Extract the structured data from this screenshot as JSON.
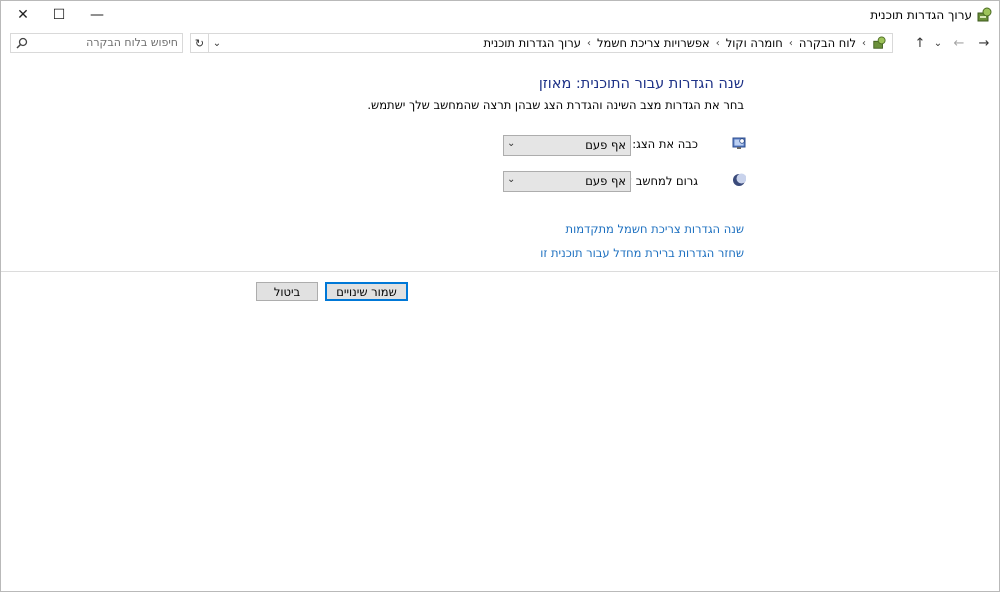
{
  "window": {
    "title": "ערוך הגדרות תוכנית",
    "close_glyph": "✕",
    "maximize_glyph": "☐",
    "minimize_glyph": "—"
  },
  "nav": {
    "back_glyph": "←",
    "forward_glyph": "→",
    "history_glyph": "⌄",
    "up_glyph": "↑",
    "refresh_glyph": "↻",
    "dropdown_glyph": "⌄",
    "breadcrumb": [
      "לוח הבקרה",
      "חומרה וקול",
      "אפשרויות צריכת חשמל",
      "ערוך הגדרות תוכנית"
    ],
    "separator": "›"
  },
  "search": {
    "placeholder": "חיפוש בלוח הבקרה",
    "value": ""
  },
  "main": {
    "heading": "שנה הגדרות עבור התוכנית: מאוזן",
    "description": "בחר את הגדרות מצב השינה והגדרת הצג שבהן תרצה שהמחשב שלך ישתמש.",
    "display_label": "כבה את הצג:",
    "display_value": "אף פעם",
    "sleep_label": "גרום למחשב לישון:",
    "sleep_value": "אף פעם",
    "advanced_link": "שנה הגדרות צריכת חשמל מתקדמות",
    "restore_link": "שחזר הגדרות ברירת מחדל עבור תוכנית זו"
  },
  "buttons": {
    "save": "שמור שינויים",
    "cancel": "ביטול"
  },
  "colors": {
    "heading": "#1e3287",
    "link": "#1a6ebf",
    "primary_border": "#0078d7"
  }
}
